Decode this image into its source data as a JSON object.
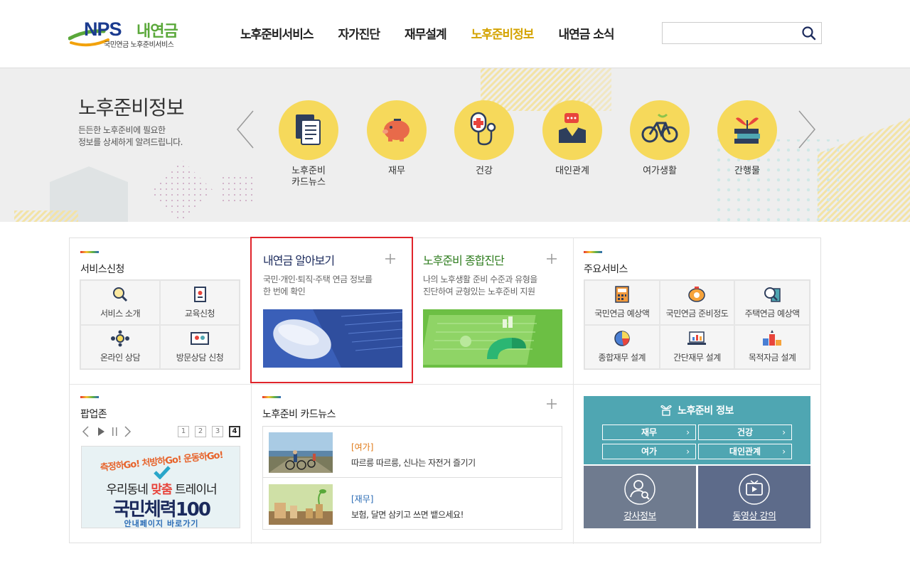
{
  "header": {
    "logo_brand": "NPS",
    "logo_name": "내연금",
    "logo_sub": "국민연금 노후준비서비스",
    "nav": [
      {
        "label": "노후준비서비스",
        "active": false
      },
      {
        "label": "자가진단",
        "active": false
      },
      {
        "label": "재무설계",
        "active": false
      },
      {
        "label": "노후준비정보",
        "active": true
      },
      {
        "label": "내연금 소식",
        "active": false
      }
    ],
    "search_value": "",
    "accent_color": "#d4a300"
  },
  "banner": {
    "title": "노후준비정보",
    "desc_line1": "든든한 노후준비에 필요한",
    "desc_line2": "정보를 상세하게 알려드립니다.",
    "categories": [
      {
        "label_line1": "노후준비",
        "label_line2": "카드뉴스",
        "icon": "cardnews-icon"
      },
      {
        "label_line1": "재무",
        "label_line2": "",
        "icon": "piggy-bank-icon"
      },
      {
        "label_line1": "건강",
        "label_line2": "",
        "icon": "stethoscope-icon"
      },
      {
        "label_line1": "대인관계",
        "label_line2": "",
        "icon": "people-chat-icon"
      },
      {
        "label_line1": "여가생활",
        "label_line2": "",
        "icon": "bicycle-icon"
      },
      {
        "label_line1": "간행물",
        "label_line2": "",
        "icon": "books-plant-icon"
      }
    ]
  },
  "service_apply": {
    "title": "서비스신청",
    "items": [
      "서비스 소개",
      "교육신청",
      "온라인 상담",
      "방문상담 신청"
    ]
  },
  "feature1": {
    "title": "내연금 알아보기",
    "desc_line1": "국민·개인·퇴직·주택 연금 정보를",
    "desc_line2": "한 번에 확인"
  },
  "feature2": {
    "title": "노후준비 종합진단",
    "desc_line1": "나의 노후생활 준비 수준과 유형을",
    "desc_line2": "진단하여 균형있는 노후준비 지원"
  },
  "main_services": {
    "title": "주요서비스",
    "items": [
      "국민연금 예상액",
      "국민연금 준비정도",
      "주택연금 예상액",
      "종합재무 설계",
      "간단재무 설계",
      "목적자금 설계"
    ]
  },
  "popup": {
    "title": "팝업존",
    "pages": [
      "1",
      "2",
      "3",
      "4"
    ],
    "active_page": "4",
    "banner_top": "측정하Go! 처방하Go! 운동하Go!",
    "banner_line1_a": "우리동네 ",
    "banner_line1_b": "맞춤",
    "banner_line1_c": " 트레이너",
    "banner_line2": "국민체력100",
    "banner_line3": "안내페이지 바로가기"
  },
  "cardnews": {
    "title": "노후준비 카드뉴스",
    "items": [
      {
        "category": "[여가]",
        "text": "따르릉 따르릉, 신나는 자전거 즐기기",
        "color": "#e07b1a"
      },
      {
        "category": "[재무]",
        "text": "보험, 달면 삼키고 쓰면 뱉으세요!",
        "color": "#2a6bb5"
      }
    ]
  },
  "info_box": {
    "title": "노후준비 정보",
    "buttons": [
      "재무",
      "건강",
      "여가",
      "대인관계"
    ],
    "lecturer": "강사정보",
    "video": "동영상 강의"
  }
}
